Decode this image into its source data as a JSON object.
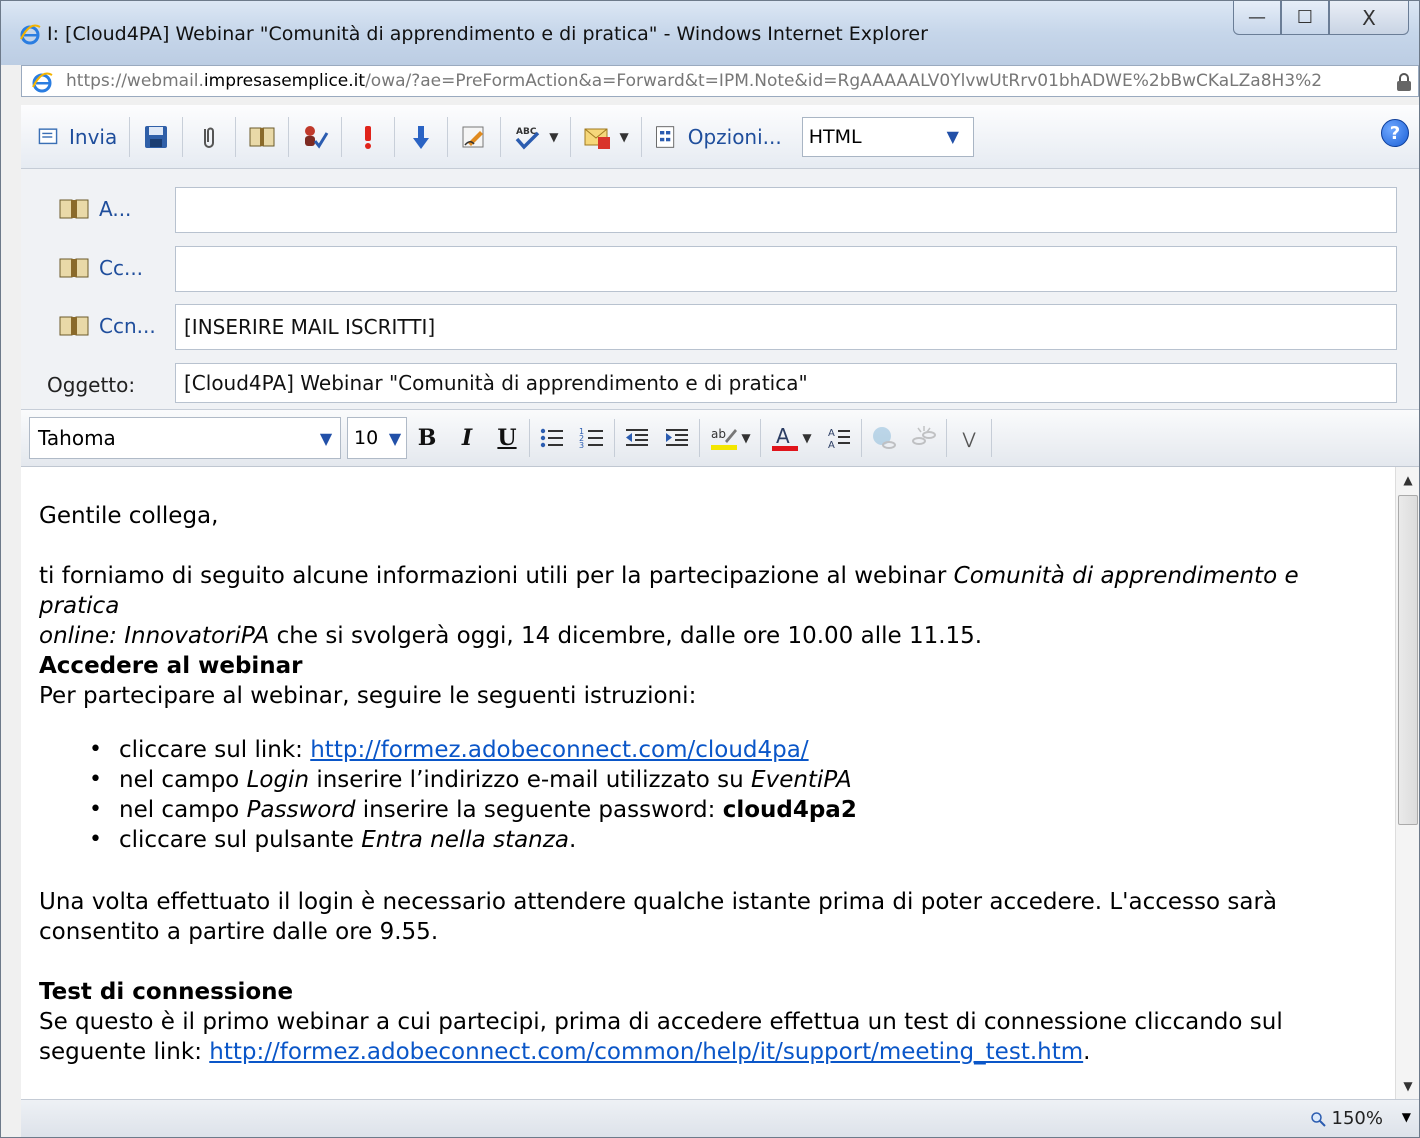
{
  "window": {
    "title": "I: [Cloud4PA] Webinar \"Comunità di apprendimento e di pratica\" - Windows Internet Explorer",
    "minimize": "—",
    "maximize": "☐",
    "close": "X"
  },
  "address": {
    "prefix": "https://webmail.",
    "domain": "impresasemplice.it",
    "path": "/owa/?ae=PreFormAction&a=Forward&t=IPM.Note&id=RgAAAAALV0YlvwUtRrv01bhADWE%2bBwCKaLZa8H3%2"
  },
  "toolbar": {
    "send_label": "Invia",
    "options_label": "Opzioni...",
    "format_value": "HTML",
    "help": "?"
  },
  "headers": {
    "to_label": "A...",
    "to_value": "",
    "cc_label": "Cc...",
    "cc_value": "",
    "bcc_label": "Ccn...",
    "bcc_value": "[INSERIRE MAIL ISCRITTI]",
    "subject_label": "Oggetto:",
    "subject_value": "[Cloud4PA] Webinar \"Comunità di apprendimento e di pratica\""
  },
  "format": {
    "font": "Tahoma",
    "size": "10",
    "bold": "B",
    "italic": "I",
    "underline": "U"
  },
  "body": {
    "greeting": "Gentile collega,",
    "intro_1": "ti forniamo di seguito alcune informazioni utili per la partecipazione al webinar ",
    "intro_title_a": "Comunità di apprendimento e pratica",
    "intro_title_b": "online: InnovatoriPA",
    "intro_2": " che si svolgerà oggi, 14 dicembre, dalle ore 10.00 alle 11.15.",
    "heading_access": "Accedere al webinar",
    "instructions": "Per partecipare al webinar, seguire le seguenti istruzioni:",
    "li1_text": "cliccare sul link: ",
    "li1_link": "http://formez.adobeconnect.com/cloud4pa/",
    "li2_a": "nel campo ",
    "li2_b": "Login",
    "li2_c": " inserire l’indirizzo e-mail utilizzato su ",
    "li2_d": "EventiPA",
    "li3_a": "nel campo ",
    "li3_b": "Password",
    "li3_c": " inserire la seguente password: ",
    "li3_d": "cloud4pa2",
    "li4_a": "cliccare sul pulsante ",
    "li4_b": "Entra nella stanza",
    "li4_c": ".",
    "login_note": "Una volta effettuato il login è necessario attendere qualche istante prima di poter accedere. L'accesso sarà consentito a partire dalle ore 9.55.",
    "heading_test": "Test di connessione",
    "test_text": "Se questo è il primo webinar a cui partecipi, prima di accedere effettua un test di connessione cliccando sul seguente link: ",
    "test_link": "http://formez.adobeconnect.com/common/help/it/support/meeting_test.htm",
    "test_end": "."
  },
  "status": {
    "zoom": "150%"
  }
}
